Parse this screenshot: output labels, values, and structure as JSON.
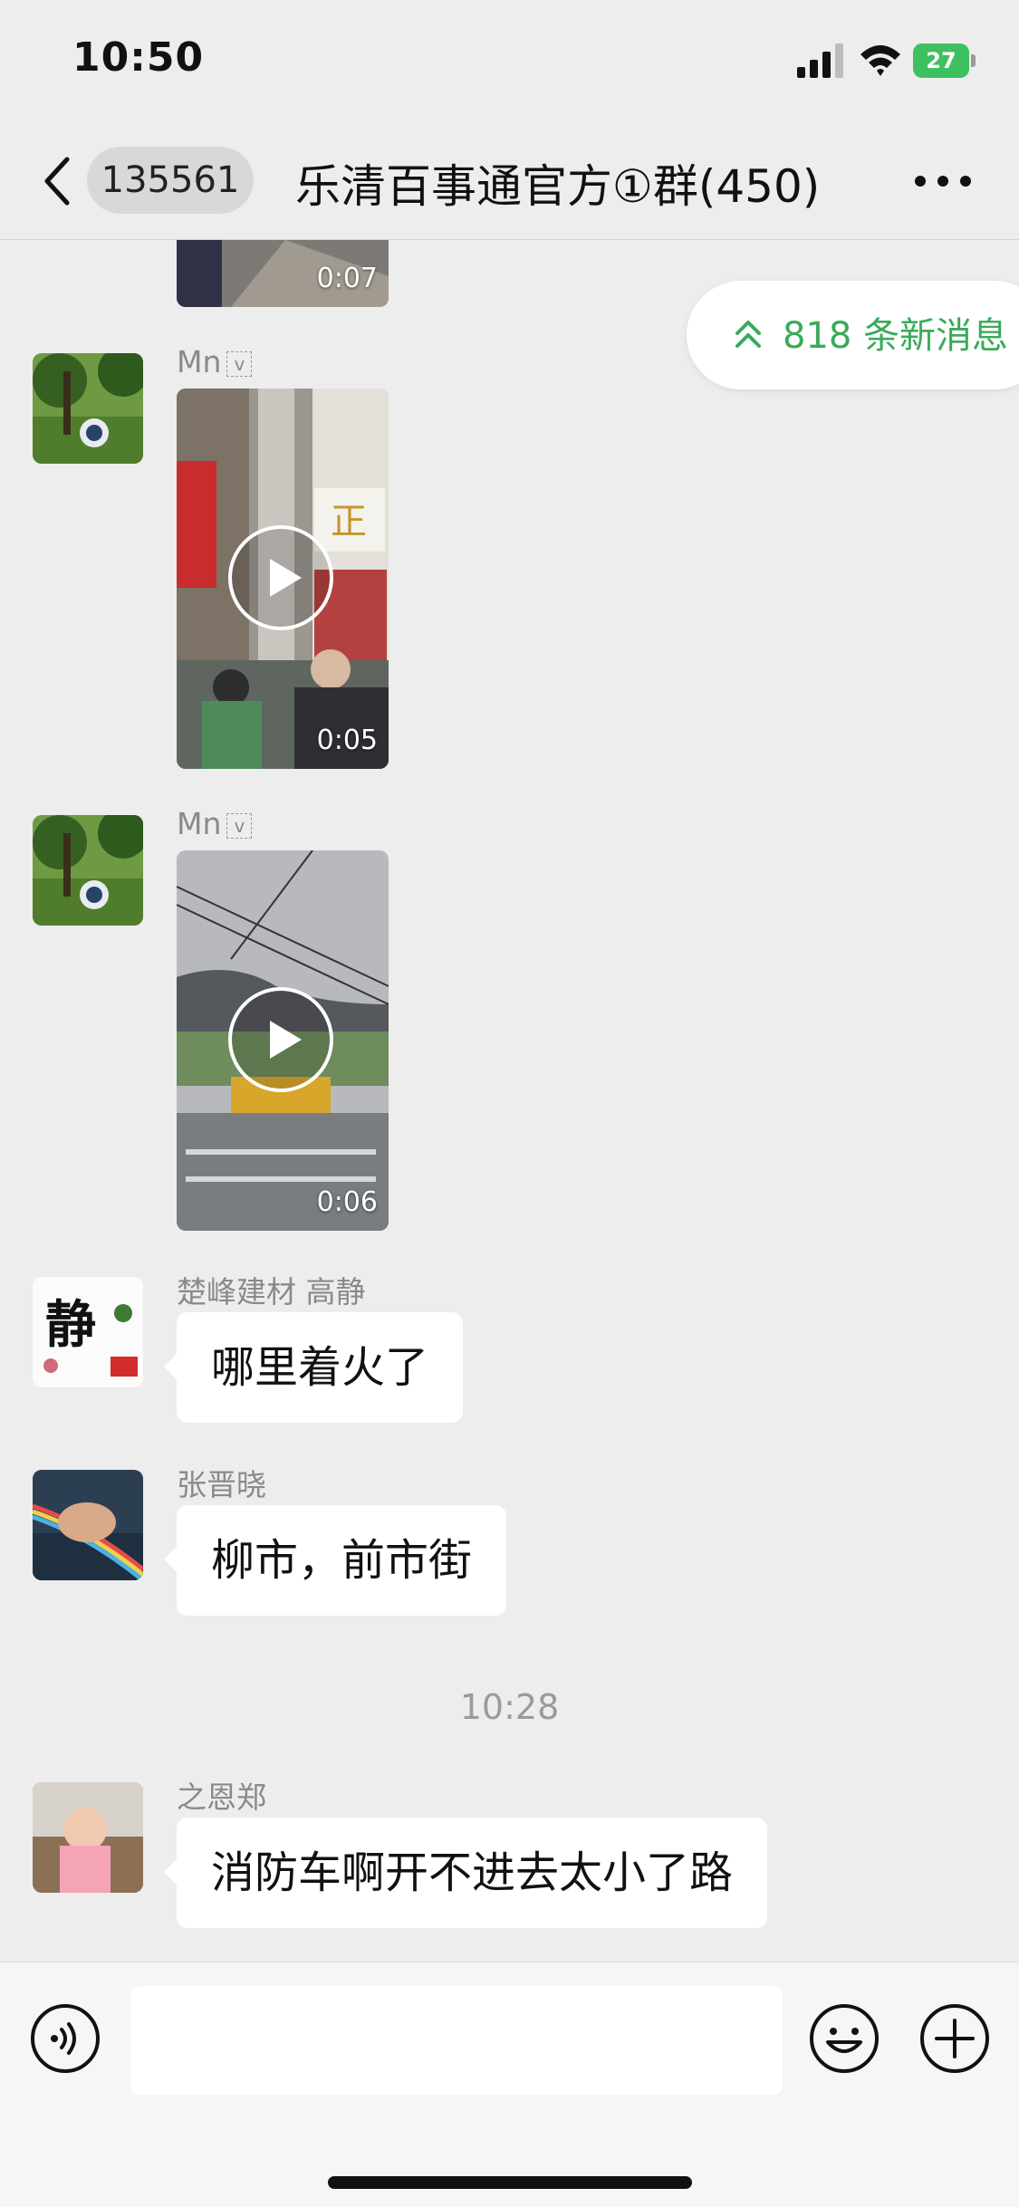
{
  "status_bar": {
    "time": "10:50",
    "battery": "27"
  },
  "nav": {
    "unread_count": "135561",
    "title": "乐清百事通官方①群(450)"
  },
  "new_messages": {
    "label": "818 条新消息"
  },
  "messages": [
    {
      "type": "video",
      "duration": "0:07"
    },
    {
      "type": "video",
      "sender": "Mn",
      "badge": "v",
      "duration": "0:05"
    },
    {
      "type": "video",
      "sender": "Mn",
      "badge": "v",
      "duration": "0:06"
    },
    {
      "type": "text",
      "sender": "楚峰建材 高静",
      "text": "哪里着火了",
      "avatar_char": "静"
    },
    {
      "type": "text",
      "sender": "张晋晓",
      "text": "柳市，前市街"
    },
    {
      "type": "timestamp",
      "text": "10:28"
    },
    {
      "type": "text",
      "sender": "之恩郑",
      "text": "消防车啊开不进去太小了路"
    }
  ],
  "icons": {
    "back": "chevron-left-icon",
    "more": "more-dots-icon",
    "voice": "voice-icon",
    "emoji": "emoji-icon",
    "plus": "plus-icon",
    "play": "play-icon"
  },
  "colors": {
    "accent": "#3aaa5a",
    "background": "#ededed",
    "bubble": "#ffffff"
  }
}
